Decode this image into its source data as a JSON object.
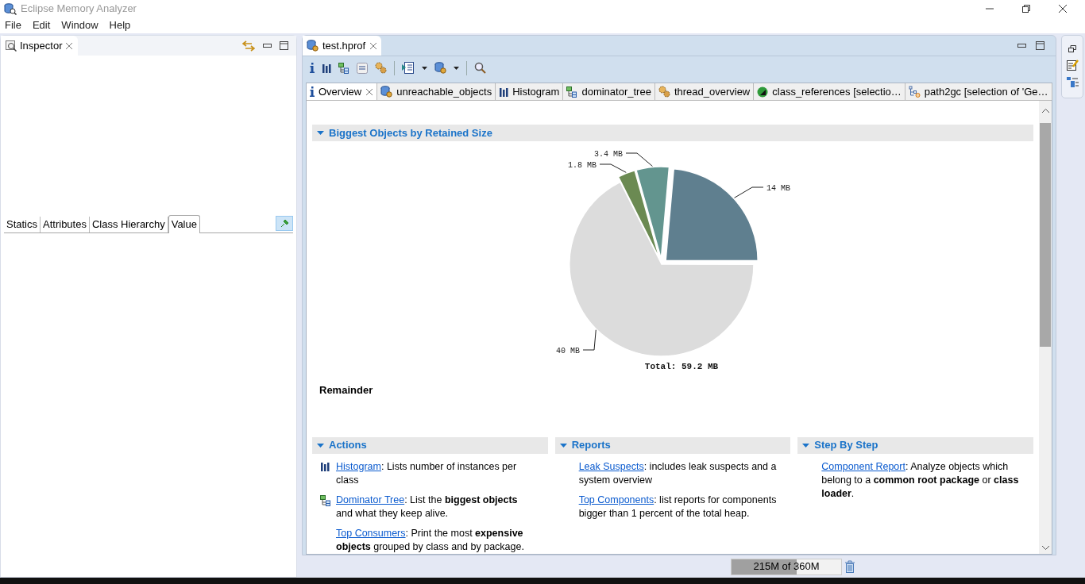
{
  "window": {
    "title": "Eclipse Memory Analyzer"
  },
  "menu": [
    "File",
    "Edit",
    "Window",
    "Help"
  ],
  "inspector": {
    "title": "Inspector",
    "tabs": [
      {
        "label": "Statics",
        "selected": false
      },
      {
        "label": "Attributes",
        "selected": false
      },
      {
        "label": "Class Hierarchy",
        "selected": false
      },
      {
        "label": "Value",
        "selected": true
      }
    ],
    "pinned": true
  },
  "editor": {
    "tab": "test.hprof",
    "tabs": [
      {
        "label": "Overview",
        "kind": "info",
        "selected": true
      },
      {
        "label": "unreachable_objects",
        "kind": "db",
        "selected": false
      },
      {
        "label": "Histogram",
        "kind": "bars",
        "selected": false
      },
      {
        "label": "dominator_tree",
        "kind": "tree",
        "selected": false
      },
      {
        "label": "thread_overview",
        "kind": "gears",
        "selected": false
      },
      {
        "label": "class_references [selectio…",
        "kind": "sphere",
        "selected": false
      },
      {
        "label": "path2gc [selection of 'Ge…",
        "kind": "path",
        "selected": false
      }
    ],
    "chart_section": {
      "title": "Biggest Objects by Retained Size",
      "expanded": true,
      "chart_data": {
        "type": "pie",
        "title": "Total: 59.2 MB",
        "values": [
          14,
          3.4,
          1.8,
          40
        ],
        "value_labels": [
          "14 MB",
          "3.4 MB",
          "1.8 MB",
          "40 MB"
        ],
        "colors": [
          "#5f7f8f",
          "#63958f",
          "#6b8a52",
          "#dcdcdc"
        ]
      },
      "caption": "Remainder"
    },
    "sections": [
      {
        "title": "Actions",
        "expanded": true,
        "items": [
          {
            "kind": "bars",
            "link": "Histogram",
            "text": ": Lists number of instances per class"
          },
          {
            "kind": "tree",
            "link": "Dominator Tree",
            "text": ": List the **biggest objects** and what they keep alive."
          },
          {
            "kind": "plain",
            "link": "Top Consumers",
            "text": ": Print the most **expensive objects** grouped by class and by package."
          }
        ]
      },
      {
        "title": "Reports",
        "expanded": true,
        "items": [
          {
            "kind": "plain",
            "link": "Leak Suspects",
            "text": ": includes leak suspects and a system overview"
          },
          {
            "kind": "plain",
            "link": "Top Components",
            "text": ": list reports for components bigger than 1 percent of the total heap."
          }
        ]
      },
      {
        "title": "Step By Step",
        "expanded": true,
        "items": [
          {
            "kind": "plain",
            "link": "Component Report",
            "text": ": Analyze objects which belong to a **common root package** or **class loader**."
          }
        ]
      }
    ]
  },
  "status_bar": {
    "memory": {
      "text": "215M of 360M",
      "level": 0.597
    }
  }
}
